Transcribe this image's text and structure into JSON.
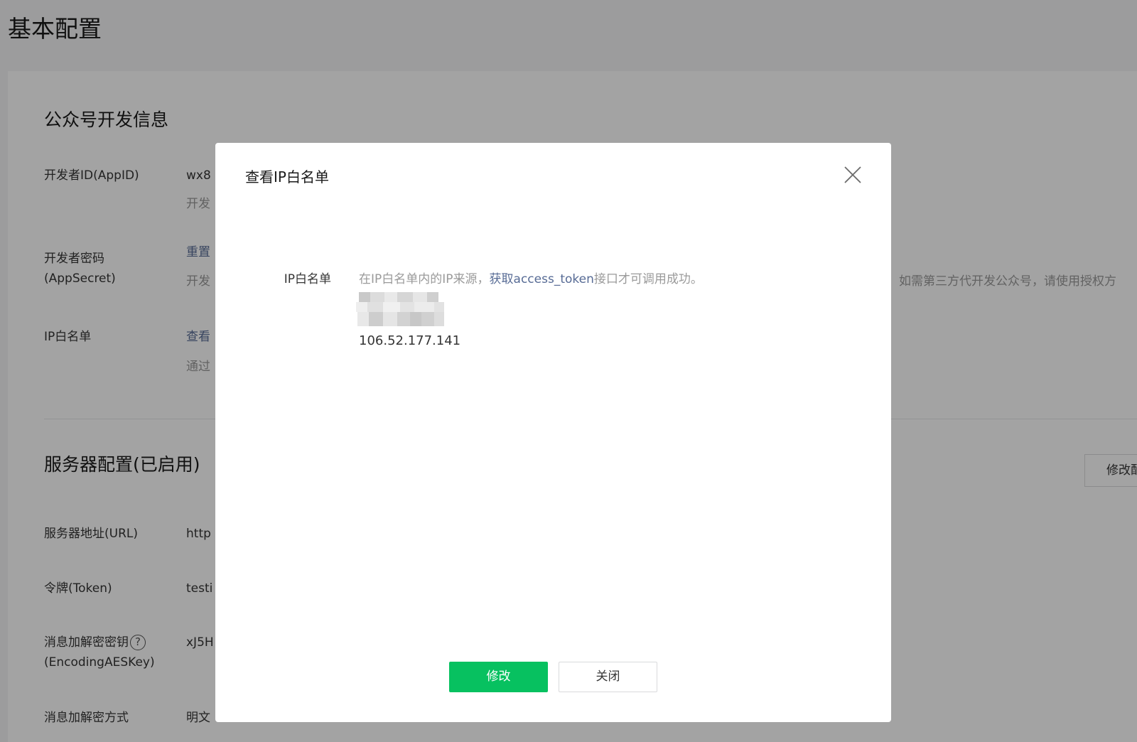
{
  "page": {
    "title": "基本配置"
  },
  "dev_info": {
    "section_title": "公众号开发信息",
    "appid_label": "开发者ID(AppID)",
    "appid_value": "wx8",
    "appid_note": "开发",
    "secret_label": "开发者密码(AppSecret)",
    "secret_link": "重置",
    "secret_note": "开发",
    "secret_note_tail": "。如需第三方代开发公众号，请使用授权方",
    "ip_label": "IP白名单",
    "ip_link": "查看",
    "ip_note": "通过"
  },
  "server_config": {
    "section_title": "服务器配置(已启用)",
    "edit_button": "修改配",
    "url_label": "服务器地址(URL)",
    "url_value": "http",
    "token_label": "令牌(Token)",
    "token_value": "testi",
    "aeskey_label_line1": "消息加解密密钥",
    "aeskey_label_line2": "(EncodingAESKey)",
    "aeskey_value": "xJ5H",
    "help_icon": "?",
    "encrypt_label": "消息加解密方式",
    "encrypt_value": "明文"
  },
  "dialog": {
    "title": "查看IP白名单",
    "form_label": "IP白名单",
    "desc_prefix": "在IP白名单内的IP来源，",
    "desc_link": "获取access_token",
    "desc_suffix": "接口才可调用成功。",
    "ip_entries": [
      "106.52.177.141"
    ],
    "primary_button": "修改",
    "secondary_button": "关闭"
  },
  "colors": {
    "primary_green": "#07c160",
    "link_blue": "#576b95",
    "mask": "rgba(0,0,0,0.36)"
  }
}
